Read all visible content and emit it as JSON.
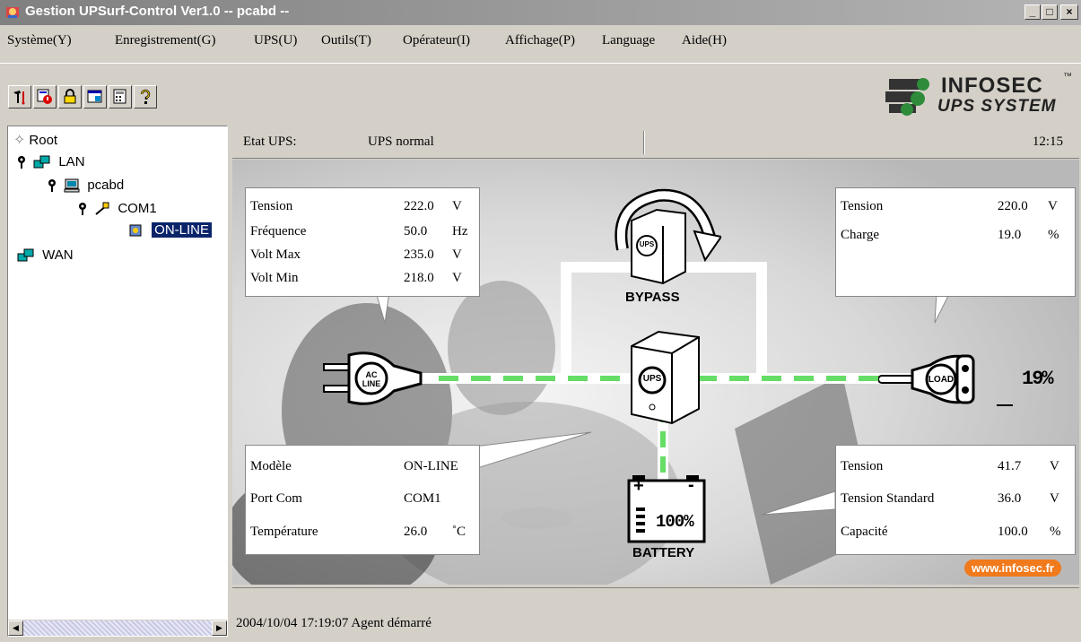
{
  "window": {
    "title": "Gestion UPSurf-Control Ver1.0 -- pcabd --",
    "min_label": "_",
    "max_label": "□",
    "close_label": "×"
  },
  "menu": [
    "Système(Y)",
    "Enregistrement(G)",
    "UPS(U)",
    "Outils(T)",
    "Opérateur(I)",
    "Affichage(P)",
    "Language",
    "Aide(H)"
  ],
  "toolbar": {
    "buttons": [
      "tools-icon",
      "schedule-icon",
      "lock-icon",
      "window-icon",
      "calculator-icon",
      "help-icon"
    ]
  },
  "logo": {
    "brand": "INFOSEC",
    "tm": "™",
    "subtitle": "UPS SYSTEM"
  },
  "tree": {
    "root": "Root",
    "lan": "LAN",
    "host": "pcabd",
    "port": "COM1",
    "device": "ON-LINE",
    "wan": "WAN"
  },
  "status": {
    "label": "Etat UPS:",
    "value": "UPS normal",
    "time": "12:15"
  },
  "input": {
    "rows": [
      {
        "label": "Tension",
        "value": "222.0",
        "unit": "V"
      },
      {
        "label": "Fréquence",
        "value": "50.0",
        "unit": "Hz"
      },
      {
        "label": "Volt Max",
        "value": "235.0",
        "unit": "V"
      },
      {
        "label": "Volt Min",
        "value": "218.0",
        "unit": "V"
      }
    ]
  },
  "output": {
    "rows": [
      {
        "label": "Tension",
        "value": "220.0",
        "unit": "V"
      },
      {
        "label": "Charge",
        "value": "19.0",
        "unit": "%"
      }
    ]
  },
  "info": {
    "rows": [
      {
        "label": "Modèle",
        "value": "ON-LINE",
        "unit": ""
      },
      {
        "label": "Port Com",
        "value": "COM1",
        "unit": ""
      },
      {
        "label": "Température",
        "value": "26.0",
        "unit": "˚C"
      }
    ]
  },
  "battery": {
    "rows": [
      {
        "label": "Tension",
        "value": "41.7",
        "unit": "V"
      },
      {
        "label": "Tension Standard",
        "value": "36.0",
        "unit": "V"
      },
      {
        "label": "Capacité",
        "value": "100.0",
        "unit": "%"
      }
    ]
  },
  "diagram": {
    "ac_line": "AC LINE",
    "ups": "UPS",
    "load": "LOAD",
    "bypass": "BYPASS",
    "battery_label": "BATTERY",
    "battery_percent": "100%",
    "load_percent": "19%",
    "plus": "+",
    "minus": "-",
    "url": "www.infosec.fr",
    "colors": {
      "flow": "#66dd66",
      "line": "#ffffff",
      "badge": "#f07a1c"
    }
  },
  "log": {
    "message": "2004/10/04 17:19:07  Agent démarré"
  }
}
